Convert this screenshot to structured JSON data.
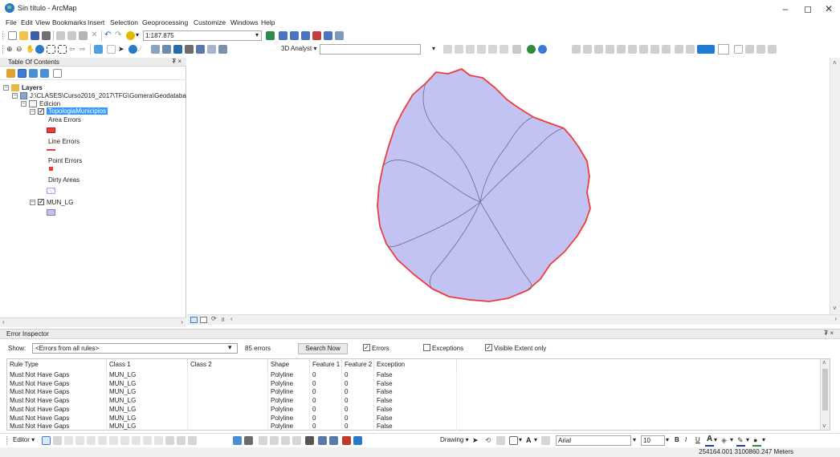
{
  "window": {
    "title": "Sin título - ArcMap",
    "minimize": "–",
    "restore": "◻",
    "close": "✕"
  },
  "menu": [
    "File",
    "Edit",
    "View",
    "Bookmarks",
    "Insert",
    "Selection",
    "Geoprocessing",
    "Customize",
    "Windows",
    "Help"
  ],
  "toolbar": {
    "scale": "1:187.875",
    "analyst_label": "3D Analyst ▾",
    "editor_label": "Editor ▾",
    "drawing_label": "Drawing ▾",
    "font_name": "Arial",
    "font_size": "10",
    "bold": "B",
    "italic": "I",
    "underline": "U",
    "text_tool": "A"
  },
  "toc": {
    "title": "Table Of Contents",
    "pin": "₮ ×",
    "layers_label": "Layers",
    "workspace_path": "J:\\CLASES\\Curso2016_2017\\TFG\\Gomera\\Geodataba",
    "dataset": "Edicion",
    "topology": "TopologiaMunicipios",
    "legend": {
      "area_errors": "Area Errors",
      "line_errors": "Line Errors",
      "point_errors": "Point Errors",
      "dirty_areas": "Dirty Areas"
    },
    "layer": "MUN_LG"
  },
  "colors": {
    "polygon_fill": "#c3c3f3",
    "polygon_outline": "#ef3b3b",
    "internal_lines": "#6b6b8a",
    "error_red": "#ee3b3b",
    "selection_blue": "#3399ff"
  },
  "error_inspector": {
    "title": "Error Inspector",
    "pin": "₮ ×",
    "show_label": "Show:",
    "show_value": "<Errors from all rules>",
    "count": "85 errors",
    "search_button": "Search Now",
    "errors_label": "Errors",
    "errors_checked": true,
    "exceptions_label": "Exceptions",
    "exceptions_checked": false,
    "visible_extent_label": "Visible Extent only",
    "visible_extent_checked": true,
    "columns": [
      "Rule Type",
      "Class 1",
      "Class 2",
      "Shape",
      "Feature 1",
      "Feature 2",
      "Exception"
    ],
    "rows": [
      [
        "Must Not Have Gaps",
        "MUN_LG",
        "",
        "Polyline",
        "0",
        "0",
        "False"
      ],
      [
        "Must Not Have Gaps",
        "MUN_LG",
        "",
        "Polyline",
        "0",
        "0",
        "False"
      ],
      [
        "Must Not Have Gaps",
        "MUN_LG",
        "",
        "Polyline",
        "0",
        "0",
        "False"
      ],
      [
        "Must Not Have Gaps",
        "MUN_LG",
        "",
        "Polyline",
        "0",
        "0",
        "False"
      ],
      [
        "Must Not Have Gaps",
        "MUN_LG",
        "",
        "Polyline",
        "0",
        "0",
        "False"
      ],
      [
        "Must Not Have Gaps",
        "MUN_LG",
        "",
        "Polyline",
        "0",
        "0",
        "False"
      ],
      [
        "Must Not Have Gaps",
        "MUN_LG",
        "",
        "Polyline",
        "0",
        "0",
        "False"
      ]
    ]
  },
  "status": {
    "coordinates": "254164.001  3100860.247 Meters"
  }
}
